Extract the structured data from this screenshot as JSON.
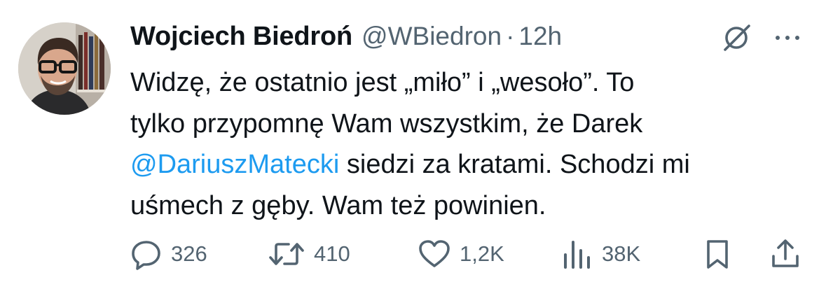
{
  "tweet": {
    "author_name": "Wojciech Biedroń",
    "handle": "@WBiedron",
    "separator": "·",
    "time": "12h",
    "text_lines": [
      "Widzę, że ostatnio jest „miło” i „wesoło”. To",
      "tylko przypomnę Wam wszystkim, że Darek",
      " siedzi za kratami. Schodzi mi",
      "uśmech z gęby. Wam też powinien."
    ],
    "mention": "@DariuszMatecki",
    "metrics": {
      "replies": "326",
      "reposts": "410",
      "likes": "1,2K",
      "views": "38K"
    }
  },
  "icons": {
    "header": [
      "grok-icon",
      "more-icon"
    ],
    "actions": [
      "reply-icon",
      "repost-icon",
      "like-icon",
      "views-icon",
      "bookmark-icon",
      "share-icon"
    ]
  },
  "colors": {
    "text": "#0f1419",
    "secondary": "#536471",
    "mention": "#1d9bf0",
    "background": "#ffffff"
  }
}
